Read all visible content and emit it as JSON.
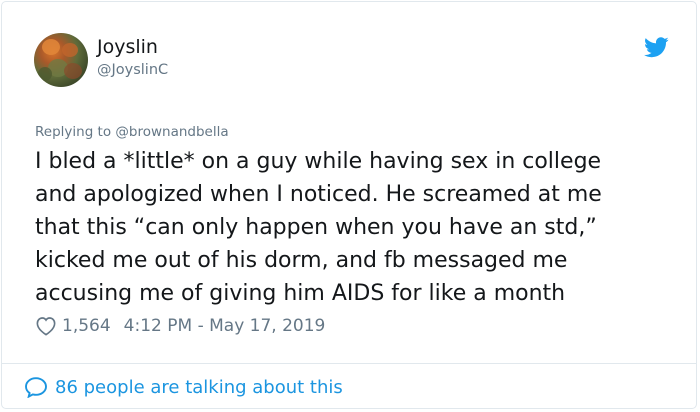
{
  "author": {
    "display_name": "Joyslin",
    "handle": "@JoyslinC"
  },
  "icons": {
    "brand": "twitter-bird-icon",
    "like": "heart-icon",
    "conversation": "speech-bubble-icon",
    "brand_color": "#1da1f2",
    "link_color": "#1b95e0"
  },
  "reply_to": "Replying to @brownandbella",
  "tweet_text": "I bled a *little* on a guy while having sex in college\nand apologized when I noticed. He screamed at me\nthat this “can only happen when you have an std,”\nkicked me out of his dorm, and fb messaged me\naccusing me of giving him AIDS for like a month",
  "likes": "1,564",
  "timestamp": "4:12 PM - May 17, 2019",
  "conversation_link": "86 people are talking about this"
}
